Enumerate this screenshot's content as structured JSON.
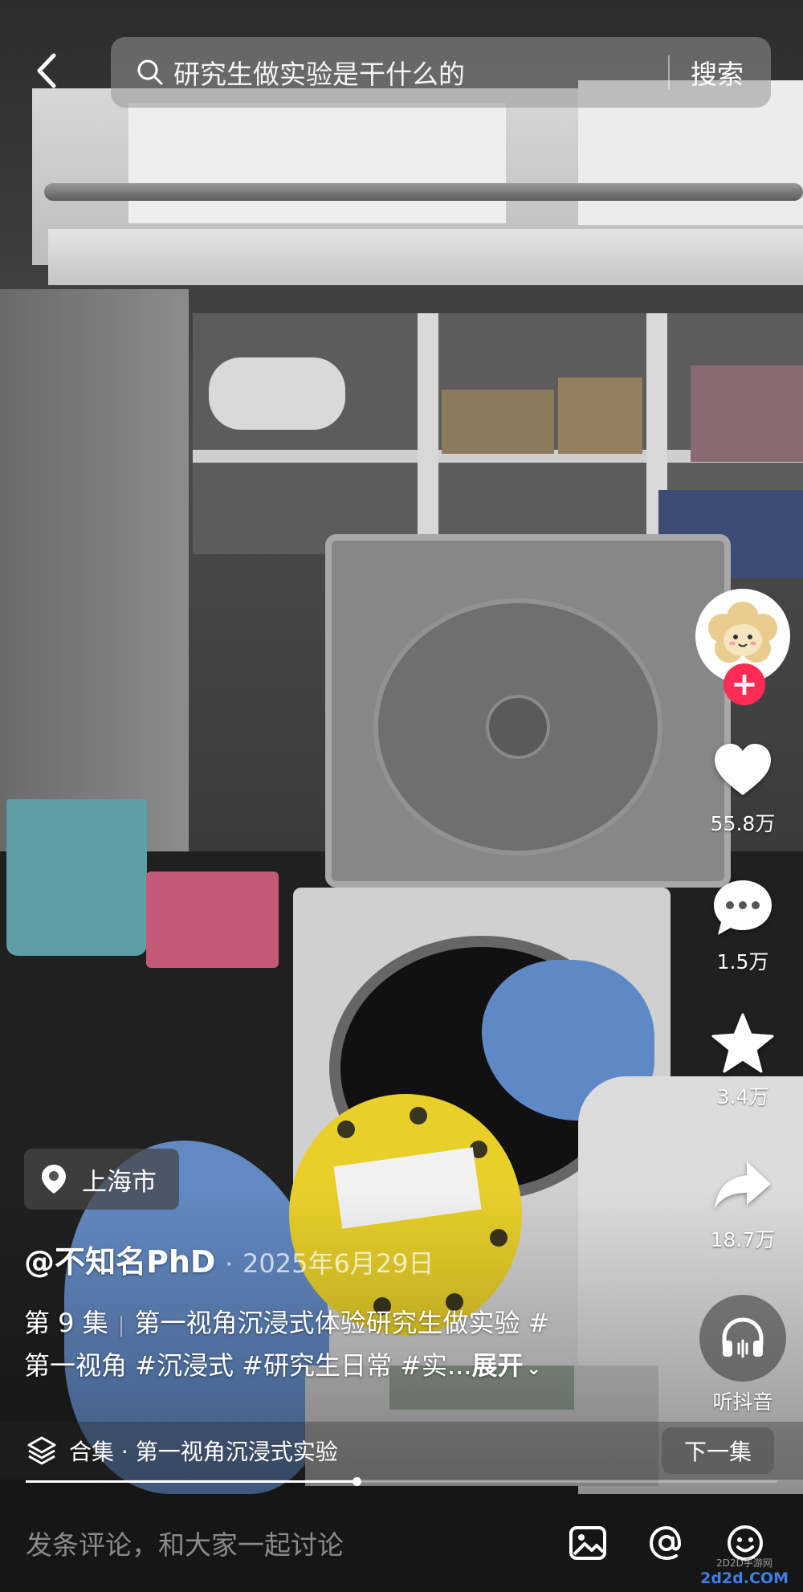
{
  "search": {
    "query": "研究生做实验是干什么的",
    "button_label": "搜索"
  },
  "actions": {
    "likes": "55.8万",
    "comments": "1.5万",
    "favorites": "3.4万",
    "shares": "18.7万",
    "listen_label": "听抖音"
  },
  "video": {
    "location": "上海市",
    "author": "@不知名PhD",
    "date": "2025年6月29日",
    "episode": "第 9 集",
    "title": "第一视角沉浸式体验研究生做实验 #",
    "tags_line": "第一视角 #沉浸式 #研究生日常 #实...",
    "expand_label": "展开",
    "progress": 0.44
  },
  "collection": {
    "label": "合集 · 第一视角沉浸式实验",
    "next_label": "下一集"
  },
  "comment_bar": {
    "placeholder": "发条评论，和大家一起讨论"
  },
  "watermark": {
    "cn": "2D2D手游网",
    "en": "2d2d.COM"
  },
  "icons": {
    "back": "chevron-left-icon",
    "search": "search-icon",
    "like": "heart-icon",
    "comment": "comment-bubble-icon",
    "favorite": "star-icon",
    "share": "share-arrow-icon",
    "listen": "headphones-icon",
    "location": "location-pin-icon",
    "collection": "layers-icon",
    "image": "image-icon",
    "mention": "at-icon",
    "emoji": "emoji-icon"
  },
  "colors": {
    "follow_accent": "#fe2c55",
    "comment_bar_bg": "#161616"
  }
}
